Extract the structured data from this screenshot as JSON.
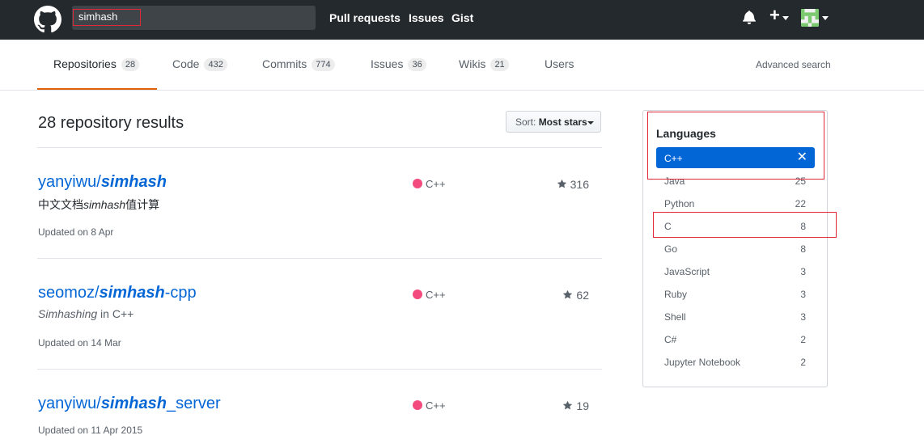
{
  "header": {
    "search_value": "simhash",
    "nav": [
      "Pull requests",
      "Issues",
      "Gist"
    ],
    "plus": "+"
  },
  "tabs": [
    {
      "label": "Repositories",
      "count": "28"
    },
    {
      "label": "Code",
      "count": "432"
    },
    {
      "label": "Commits",
      "count": "774"
    },
    {
      "label": "Issues",
      "count": "36"
    },
    {
      "label": "Wikis",
      "count": "21"
    },
    {
      "label": "Users",
      "count": ""
    }
  ],
  "advanced_search": "Advanced search",
  "results_title": "28 repository results",
  "sort": {
    "label": "Sort:",
    "value": "Most stars"
  },
  "repos": [
    {
      "owner": "yanyiwu/",
      "match": "simhash",
      "suffix": "",
      "desc_pre": "中文文档",
      "desc_match": "simhash",
      "desc_post": "值计算",
      "language": "C++",
      "stars": "316",
      "updated": "Updated on 8 Apr"
    },
    {
      "owner": "seomoz/",
      "match": "simhash",
      "suffix": "-cpp",
      "desc_pre": "",
      "desc_match": "Simhashing",
      "desc_post": " in C++",
      "language": "C++",
      "stars": "62",
      "updated": "Updated on 14 Mar"
    },
    {
      "owner": "yanyiwu/",
      "match": "simhash",
      "suffix": "_server",
      "desc_pre": "",
      "desc_match": "",
      "desc_post": "",
      "language": "C++",
      "stars": "19",
      "updated": "Updated on 11 Apr 2015"
    }
  ],
  "languages": {
    "title": "Languages",
    "selected": "C++",
    "close_symbol": "✕",
    "items": [
      {
        "name": "Java",
        "count": "25"
      },
      {
        "name": "Python",
        "count": "22"
      },
      {
        "name": "C",
        "count": "8"
      },
      {
        "name": "Go",
        "count": "8"
      },
      {
        "name": "JavaScript",
        "count": "3"
      },
      {
        "name": "Ruby",
        "count": "3"
      },
      {
        "name": "Shell",
        "count": "3"
      },
      {
        "name": "C#",
        "count": "2"
      },
      {
        "name": "Jupyter Notebook",
        "count": "2"
      }
    ]
  },
  "colors": {
    "header_bg": "#24292e",
    "link": "#0366d6",
    "tab_underline": "#e36209",
    "cpp_dot": "#f34b7d",
    "annotation": "#e0283a"
  }
}
